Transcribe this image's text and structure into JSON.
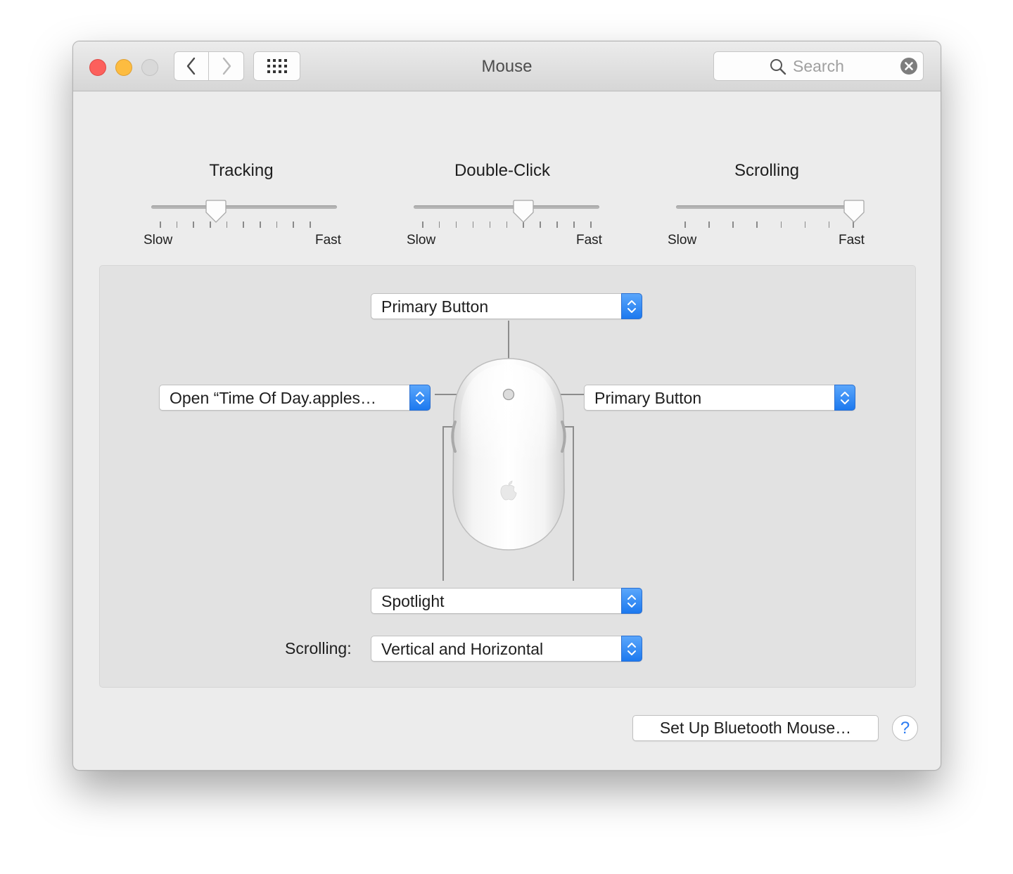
{
  "window": {
    "title": "Mouse"
  },
  "toolbar": {
    "back_icon": "chevron-left-icon",
    "forward_icon": "chevron-right-icon",
    "grid_icon": "show-all-grid-icon",
    "search_placeholder": "Search",
    "search_icon": "search-icon",
    "clear_icon": "clear-circle-icon"
  },
  "sliders": [
    {
      "title": "Tracking",
      "min_label": "Slow",
      "max_label": "Fast",
      "ticks": 10,
      "value_fraction": 0.35
    },
    {
      "title": "Double-Click",
      "min_label": "Slow",
      "max_label": "Fast",
      "ticks": 11,
      "value_fraction": 0.59
    },
    {
      "title": "Scrolling",
      "min_label": "Slow",
      "max_label": "Fast",
      "ticks": 8,
      "value_fraction": 0.95
    }
  ],
  "buttons_panel": {
    "top_popup": "Primary Button",
    "left_popup": "Open “Time Of Day.apples…",
    "right_popup": "Primary Button",
    "bottom_popup": "Spotlight",
    "scrolling_label": "Scrolling:",
    "scrolling_popup": "Vertical and Horizontal"
  },
  "footer": {
    "setup_button": "Set Up Bluetooth Mouse…",
    "help_button": "?"
  },
  "colors": {
    "accent": "#1c79ef",
    "close": "#fc605c",
    "minimize": "#fdbc40",
    "zoom_disabled": "#d9d9d9"
  }
}
